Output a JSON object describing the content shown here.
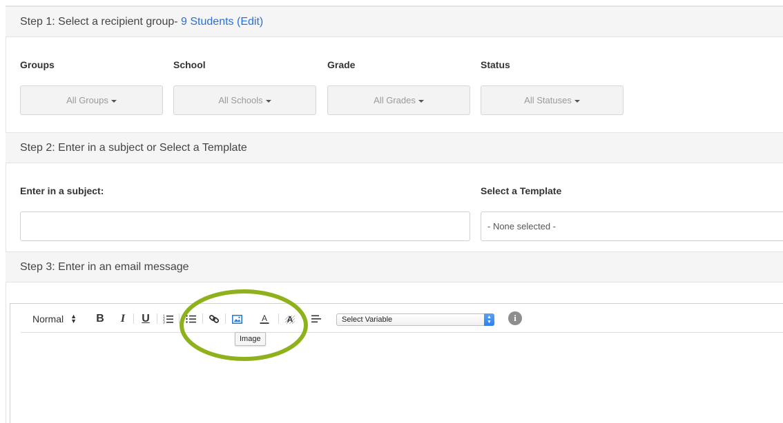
{
  "step1": {
    "prefix": "Step 1: Select a recipient group- ",
    "count_link": "9 Students",
    "edit_link": "(Edit)"
  },
  "filters": {
    "groups_label": "Groups",
    "groups_value": "All Groups",
    "school_label": "School",
    "school_value": "All Schools",
    "grade_label": "Grade",
    "grade_value": "All Grades",
    "status_label": "Status",
    "status_value": "All Statuses"
  },
  "step2": {
    "title": "Step 2: Enter in a subject or Select a Template",
    "subject_label": "Enter in a subject:",
    "subject_value": "",
    "template_label": "Select a Template",
    "template_value": "- None selected -"
  },
  "step3": {
    "title": "Step 3: Enter in an email message"
  },
  "toolbar": {
    "format_value": "Normal",
    "bold_label": "B",
    "italic_label": "I",
    "underline_label": "U",
    "variable_value": "Select Variable",
    "tooltip_text": "Image",
    "info_label": "i"
  },
  "colors": {
    "accent_link": "#2a6fd6",
    "highlight_circle": "#8fb21c",
    "image_icon": "#2a7fd4"
  },
  "icons": [
    "ordered-list-icon",
    "bullet-list-icon",
    "link-icon",
    "image-icon",
    "text-color-icon",
    "background-color-icon",
    "align-left-icon",
    "info-icon"
  ]
}
